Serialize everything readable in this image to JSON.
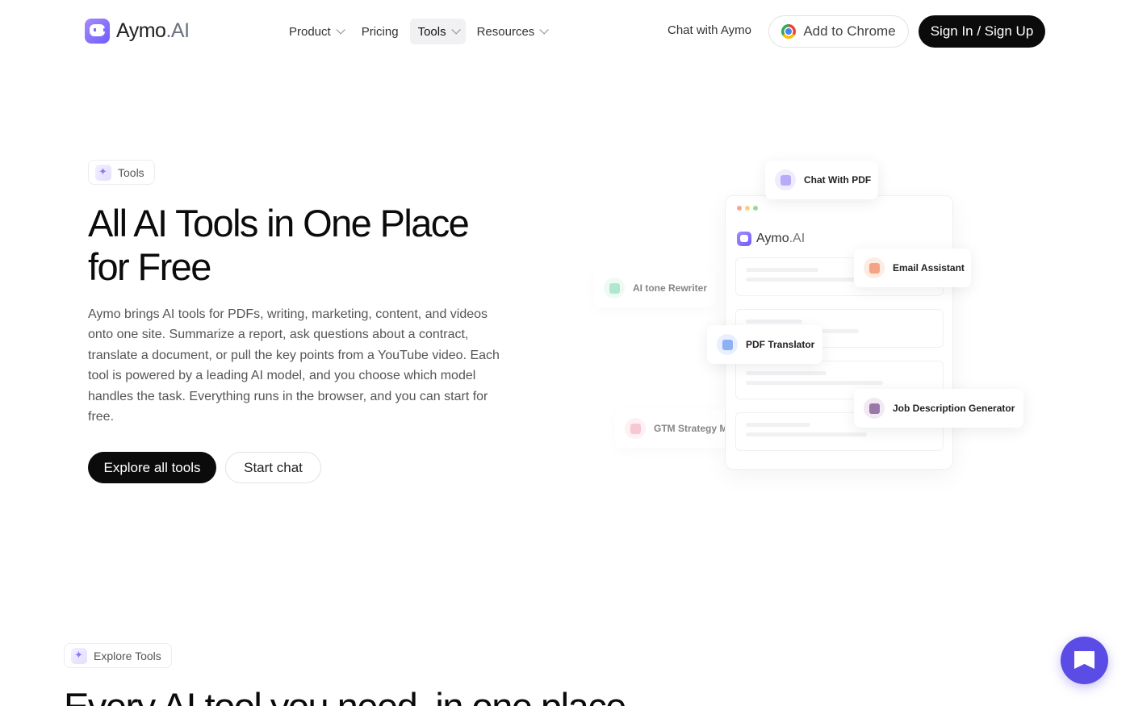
{
  "nav": {
    "logo_main": "Aymo",
    "logo_suffix": ".AI",
    "menu": [
      {
        "label": "Product",
        "has_dropdown": true,
        "active": false
      },
      {
        "label": "Pricing",
        "has_dropdown": false,
        "active": false
      },
      {
        "label": "Tools",
        "has_dropdown": true,
        "active": true
      },
      {
        "label": "Resources",
        "has_dropdown": true,
        "active": false
      }
    ],
    "chat_link": "Chat with Aymo",
    "chrome_button": "Add to Chrome",
    "sign_button": "Sign In / Sign Up"
  },
  "hero": {
    "badge": "Tools",
    "title_line1": "All AI Tools in One Place",
    "title_line2": "for Free",
    "description": "Aymo brings AI tools for PDFs, writing, marketing, content, and videos onto one site. Summarize a report, ask questions about a contract, translate a document, or pull the key points from a YouTube video. Each tool is powered by a leading AI model, and you choose which model handles the task. Everything runs in the browser, and you can start for free.",
    "primary_cta": "Explore all tools",
    "secondary_cta": "Start chat"
  },
  "illustration": {
    "window_logo_main": "Aymo",
    "window_logo_suffix": ".AI",
    "cards": [
      {
        "label": "Chat With PDF",
        "icon": "pdf-chat-icon",
        "color": "#8b7cf6",
        "bg": "#efecfe"
      },
      {
        "label": "Email Assistant",
        "icon": "email-icon",
        "color": "#f08a5d",
        "bg": "#fdece4"
      },
      {
        "label": "AI tone Rewriter",
        "icon": "edit-icon",
        "color": "#34c78a",
        "bg": "#e3f7ee"
      },
      {
        "label": "PDF Translator",
        "icon": "translate-icon",
        "color": "#5b8def",
        "bg": "#e8efff"
      },
      {
        "label": "Job Description Generator",
        "icon": "briefcase-icon",
        "color": "#7d5a8c",
        "bg": "#f1e9f4"
      },
      {
        "label": "GTM Strategy M",
        "icon": "chart-icon",
        "color": "#ec6f8e",
        "bg": "#fde6ec"
      }
    ]
  },
  "explore": {
    "badge": "Explore Tools",
    "title": "Every AI tool you need, in one place"
  },
  "colors": {
    "brand": "#6d5dfc",
    "fab": "#5b4ce6",
    "dark": "#0b0b0c"
  }
}
